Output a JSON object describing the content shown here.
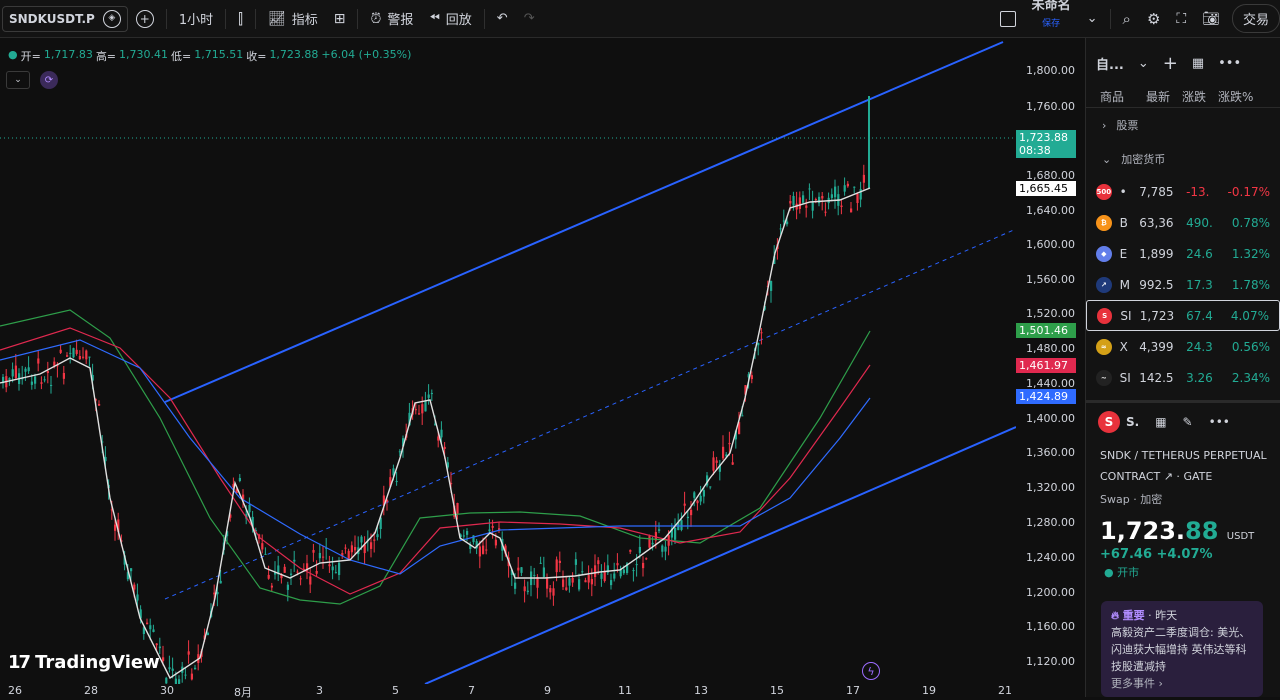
{
  "toolbar": {
    "symbol": "SNDKUSDT.P",
    "interval": "1小时",
    "indicators": "指标",
    "alert": "警报",
    "replay": "回放",
    "layout_name": "未命名",
    "layout_save": "保存",
    "trade": "交易"
  },
  "legend": {
    "open_label": "开=",
    "open": "1,717.83",
    "high_label": "高=",
    "high": "1,730.41",
    "low_label": "低=",
    "low": "1,715.51",
    "close_label": "收=",
    "close": "1,723.88",
    "change": "+6.04 (+0.35%)"
  },
  "price_axis": {
    "ticks": [
      "1,800.00",
      "1,760.00",
      "1,680.00",
      "1,640.00",
      "1,600.00",
      "1,560.00",
      "1,520.00",
      "1,480.00",
      "1,440.00",
      "1,400.00",
      "1,360.00",
      "1,320.00",
      "1,280.00",
      "1,240.00",
      "1,200.00",
      "1,160.00",
      "1,120.00"
    ],
    "last_price": "1,723.88",
    "countdown": "08:38",
    "tag_ma1": "1,665.45",
    "tag_ma2": "1,501.46",
    "tag_ma3": "1,461.97",
    "tag_ma4": "1,424.89"
  },
  "time_axis": [
    "26",
    "28",
    "30",
    "8月",
    "3",
    "5",
    "7",
    "9",
    "11",
    "13",
    "15",
    "17",
    "19",
    "21"
  ],
  "brand": "TradingView",
  "colors": {
    "up": "#22ab94",
    "down": "#f23645",
    "channel": "#2962ff",
    "ma_white": "#e0e0e0",
    "ma_green": "#2e9e4a",
    "ma_red": "#e0294f",
    "ma_blue": "#2f6bff"
  },
  "watchlist": {
    "title": "自...",
    "columns": [
      "商品",
      "最新",
      "涨跌",
      "涨跌%"
    ],
    "section_stocks": "股票",
    "section_crypto": "加密货币",
    "rows": [
      {
        "icon_text": "500",
        "icon_color": "#e8323c",
        "sym": "•",
        "last": "7,785",
        "chg": "-13.",
        "pct": "-0.17%",
        "dir": "dn"
      },
      {
        "icon_text": "₿",
        "icon_color": "#f7931a",
        "sym": "B",
        "last": "63,36",
        "chg": "490.",
        "pct": "0.78%",
        "dir": "up"
      },
      {
        "icon_text": "◆",
        "icon_color": "#627eea",
        "sym": "E",
        "last": "1,899",
        "chg": "24.6",
        "pct": "1.32%",
        "dir": "up"
      },
      {
        "icon_text": "↗",
        "icon_color": "#1f3a7a",
        "sym": "M",
        "last": "992.5",
        "chg": "17.3",
        "pct": "1.78%",
        "dir": "up"
      },
      {
        "icon_text": "S",
        "icon_color": "#e8323c",
        "sym": "SI",
        "last": "1,723",
        "chg": "67.4",
        "pct": "4.07%",
        "dir": "up"
      },
      {
        "icon_text": "≈",
        "icon_color": "#d4a017",
        "sym": "X",
        "last": "4,399",
        "chg": "24.3",
        "pct": "0.56%",
        "dir": "up"
      },
      {
        "icon_text": "~",
        "icon_color": "#222",
        "sym": "SI",
        "last": "142.5",
        "chg": "3.26",
        "pct": "2.34%",
        "dir": "up"
      }
    ]
  },
  "detail": {
    "short": "S.",
    "desc1": "SNDK / TETHERUS PERPETUAL",
    "desc2": "CONTRACT",
    "exchange": "GATE",
    "type": "Swap · 加密",
    "price_int": "1,723.",
    "price_dec": "88",
    "currency": "USDT",
    "change": "+67.46  +4.07%",
    "status": "● 开市",
    "news_tag": "重要",
    "news_time": "· 昨天",
    "news_text": "高毅资产二季度调仓: 美光、闪迪获大幅增持 英伟达等科技股遭减持",
    "news_more": "更多事件 ›"
  }
}
